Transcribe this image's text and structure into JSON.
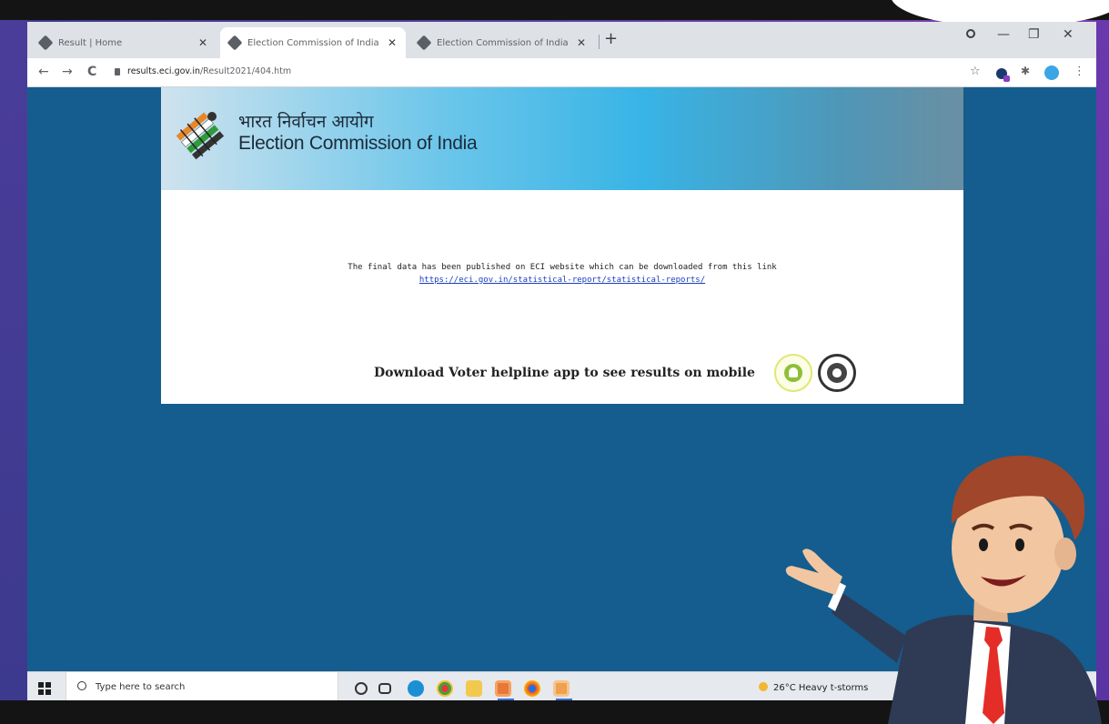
{
  "browser": {
    "tabs": [
      {
        "label": "Result | Home",
        "active": false
      },
      {
        "label": "Election Commission of India",
        "active": true
      },
      {
        "label": "Election Commission of India",
        "active": false
      }
    ],
    "new_tab": "+",
    "url": {
      "host": "results.eci.gov.in",
      "path": "/Result2021/404.htm"
    },
    "nav": {
      "back": "←",
      "forward": "→",
      "reload": "C"
    },
    "bookmark_star": "☆",
    "menu": "⋮",
    "window": {
      "minimize": "—",
      "maximize": "❐",
      "close": "✕"
    },
    "icons": [
      "circle-indicator-icon",
      "extension-icon",
      "puzzle-icon",
      "profile-icon"
    ]
  },
  "page": {
    "title_hindi": "भारत निर्वाचन आयोग",
    "title_english": "Election Commission of India",
    "message": "The final data has been published on ECI website which can be downloaded from this link",
    "link": "https://eci.gov.in/statistical-report/statistical-reports/",
    "download_text": "Download Voter helpline app to see results on mobile",
    "apps": [
      "android-icon",
      "apple-icon"
    ]
  },
  "taskbar": {
    "search_placeholder": "Type here to search",
    "weather": "26°C  Heavy t-storms",
    "task_view": "⊏⊐",
    "cortana": "O"
  },
  "colors": {
    "page_bg": "#145d8e",
    "link": "#1a3fbf",
    "android": "#8fbf37"
  }
}
